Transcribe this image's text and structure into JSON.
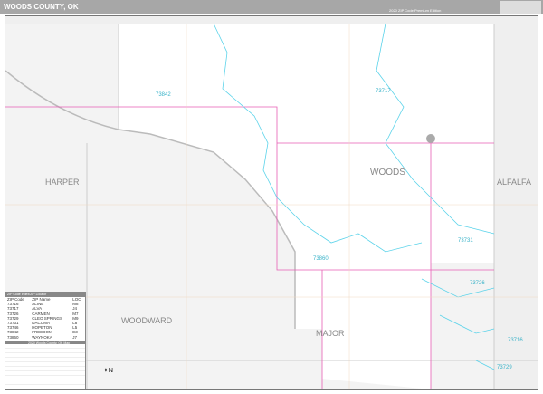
{
  "header": {
    "title": "WOODS COUNTY, OK",
    "edition": "2020 ZIP Code Premium Edition",
    "logo_text": "Marketmaps"
  },
  "map": {
    "counties": [
      {
        "name": "WOODS"
      },
      {
        "name": "HARPER"
      },
      {
        "name": "ALFALFA"
      },
      {
        "name": "WOODWARD"
      },
      {
        "name": "MAJOR"
      }
    ],
    "zip_labels": [
      "73717",
      "73842",
      "73860",
      "73731",
      "73726",
      "73716",
      "73729"
    ],
    "colors": {
      "zip_boundary": "#5bd3ea",
      "county_boundary": "#e75fb5",
      "outside_county": "#eeeeee",
      "roads": "#f0c8a0"
    }
  },
  "legend": {
    "header": "ZIP Code Index/ZIP Locator",
    "columns": [
      "ZIP Code",
      "ZIP Name",
      "LOC"
    ],
    "rows": [
      [
        "73716",
        "ALINE",
        "M8"
      ],
      [
        "73717",
        "ALVA",
        "J4"
      ],
      [
        "73726",
        "CARMEN",
        "M7"
      ],
      [
        "73729",
        "CLEO SPRINGS",
        "M9"
      ],
      [
        "73731",
        "DACOMA",
        "L8"
      ],
      [
        "73746",
        "HOPETON",
        "L5"
      ],
      [
        "73842",
        "FREEDOM",
        "E3"
      ],
      [
        "73860",
        "WAYNOKA",
        "J7"
      ]
    ],
    "subheader": "2020 Woods County, OK Map"
  },
  "compass": "N"
}
